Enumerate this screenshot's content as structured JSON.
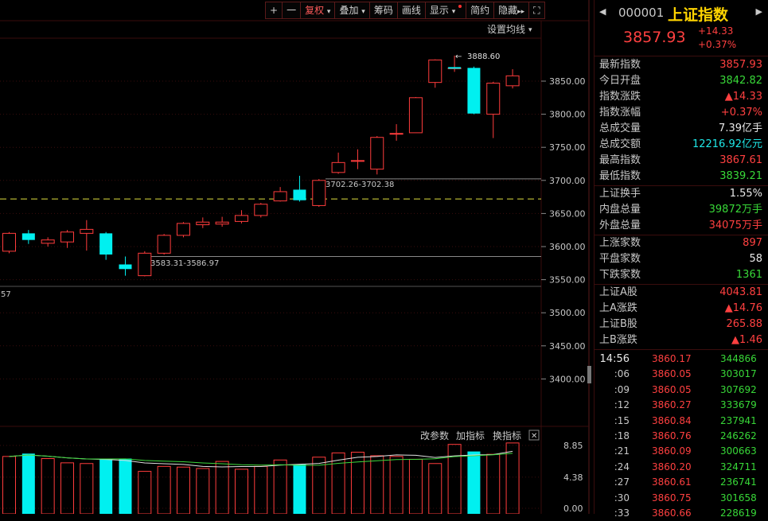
{
  "toolbar": {
    "plus": "+",
    "minus": "一",
    "fuquan": "复权",
    "diejia": "叠加",
    "chouma": "筹码",
    "huaxian": "画线",
    "xianshi": "显示",
    "jianyue": "简约",
    "yincang": "隐藏",
    "scroll_right": "▸▸",
    "fullscreen": "⛶"
  },
  "header": {
    "code": "000001",
    "name": "上证指数",
    "price": "3857.93",
    "change": "+14.33",
    "change_pct": "+0.37%",
    "nav_left": "◀",
    "nav_right": "▶"
  },
  "labels": {
    "set_ma": "设置均线",
    "high_marker": "3888.60",
    "range_top": "3702.26-3702.38",
    "range_bottom": "3583.31-3586.97",
    "lower_tag": "57",
    "gai_canshu": "改参数",
    "jia_zhibiao": "加指标",
    "huan_zhibiao": "换指标",
    "close_x": "✕"
  },
  "stats1": [
    {
      "label": "最新指数",
      "value": "3857.93",
      "color": "red"
    },
    {
      "label": "今日开盘",
      "value": "3842.82",
      "color": "green"
    },
    {
      "label": "指数涨跌",
      "value": "▲14.33",
      "color": "red"
    },
    {
      "label": "指数涨幅",
      "value": "+0.37%",
      "color": "red"
    },
    {
      "label": "总成交量",
      "value": "7.39亿手",
      "color": "white"
    },
    {
      "label": "总成交额",
      "value": "12216.92亿元",
      "color": "cyan"
    },
    {
      "label": "最高指数",
      "value": "3867.61",
      "color": "red"
    },
    {
      "label": "最低指数",
      "value": "3839.21",
      "color": "green"
    }
  ],
  "stats2": [
    {
      "label": "上证换手",
      "value": "1.55%",
      "color": "white"
    },
    {
      "label": "内盘总量",
      "value": "39872万手",
      "color": "green"
    },
    {
      "label": "外盘总量",
      "value": "34075万手",
      "color": "red"
    }
  ],
  "stats3": [
    {
      "label": "上涨家数",
      "value": "897",
      "color": "red"
    },
    {
      "label": "平盘家数",
      "value": "58",
      "color": "white"
    },
    {
      "label": "下跌家数",
      "value": "1361",
      "color": "green"
    }
  ],
  "stats4": [
    {
      "label": "上证A股",
      "value": "4043.81",
      "color": "red"
    },
    {
      "label": "上A涨跌",
      "value": "▲14.76",
      "color": "red"
    },
    {
      "label": "上证B股",
      "value": "265.88",
      "color": "red"
    },
    {
      "label": "上B涨跌",
      "value": "▲1.46",
      "color": "red"
    }
  ],
  "ticks": [
    {
      "time": "14:56",
      "price": "3860.17",
      "vol": "344866"
    },
    {
      "time": ":06",
      "price": "3860.05",
      "vol": "303017"
    },
    {
      "time": ":09",
      "price": "3860.05",
      "vol": "307692"
    },
    {
      "time": ":12",
      "price": "3860.27",
      "vol": "333679"
    },
    {
      "time": ":15",
      "price": "3860.84",
      "vol": "237941"
    },
    {
      "time": ":18",
      "price": "3860.76",
      "vol": "246262"
    },
    {
      "time": ":21",
      "price": "3860.09",
      "vol": "300663"
    },
    {
      "time": ":24",
      "price": "3860.20",
      "vol": "324711"
    },
    {
      "time": ":27",
      "price": "3860.61",
      "vol": "236741"
    },
    {
      "time": ":30",
      "price": "3860.75",
      "vol": "301658"
    },
    {
      "time": ":33",
      "price": "3860.66",
      "vol": "228619"
    }
  ],
  "colors": {
    "up": "#ff3c3c",
    "down": "#00f0f0",
    "grid": "#3a0d0d",
    "ma_white": "#d8d8d8",
    "ma_yellow": "#e8e060",
    "vol_ma1": "#e0e0e0",
    "vol_ma2": "#3cd83c"
  },
  "chart_data": {
    "type": "candlestick",
    "y_ticks": [
      "3850.00",
      "3800.00",
      "3750.00",
      "3700.00",
      "3650.00",
      "3600.00",
      "3550.00",
      "3500.00",
      "3450.00",
      "3400.00"
    ],
    "ylim": [
      3370,
      3905
    ],
    "reference_line": 3672,
    "candles": [
      {
        "o": 3593,
        "c": 3620,
        "h": 3622,
        "l": 3590
      },
      {
        "o": 3620,
        "c": 3610,
        "h": 3625,
        "l": 3604
      },
      {
        "o": 3605,
        "c": 3610,
        "h": 3614,
        "l": 3600
      },
      {
        "o": 3607,
        "c": 3622,
        "h": 3625,
        "l": 3598
      },
      {
        "o": 3620,
        "c": 3626,
        "h": 3640,
        "l": 3594
      },
      {
        "o": 3620,
        "c": 3588,
        "h": 3622,
        "l": 3580
      },
      {
        "o": 3573,
        "c": 3566,
        "h": 3585,
        "l": 3556
      },
      {
        "o": 3556,
        "c": 3590,
        "h": 3593,
        "l": 3555
      },
      {
        "o": 3590,
        "c": 3617,
        "h": 3619,
        "l": 3588
      },
      {
        "o": 3617,
        "c": 3635,
        "h": 3637,
        "l": 3614
      },
      {
        "o": 3633,
        "c": 3637,
        "h": 3644,
        "l": 3628
      },
      {
        "o": 3634,
        "c": 3637,
        "h": 3645,
        "l": 3630
      },
      {
        "o": 3638,
        "c": 3647,
        "h": 3655,
        "l": 3635
      },
      {
        "o": 3647,
        "c": 3664,
        "h": 3666,
        "l": 3644
      },
      {
        "o": 3669,
        "c": 3683,
        "h": 3690,
        "l": 3668
      },
      {
        "o": 3686,
        "c": 3670,
        "h": 3707,
        "l": 3668
      },
      {
        "o": 3662,
        "c": 3700,
        "h": 3702,
        "l": 3660
      },
      {
        "o": 3712,
        "c": 3727,
        "h": 3742,
        "l": 3710
      },
      {
        "o": 3730,
        "c": 3730,
        "h": 3747,
        "l": 3717
      },
      {
        "o": 3717,
        "c": 3765,
        "h": 3767,
        "l": 3709
      },
      {
        "o": 3770,
        "c": 3771,
        "h": 3785,
        "l": 3760
      },
      {
        "o": 3772,
        "c": 3825,
        "h": 3826,
        "l": 3772
      },
      {
        "o": 3848,
        "c": 3882,
        "h": 3883,
        "l": 3840
      },
      {
        "o": 3870,
        "c": 3870,
        "h": 3888.6,
        "l": 3864
      },
      {
        "o": 3870,
        "c": 3801,
        "h": 3872,
        "l": 3800
      },
      {
        "o": 3800,
        "c": 3847,
        "h": 3849,
        "l": 3764
      },
      {
        "o": 3843,
        "c": 3858,
        "h": 3868,
        "l": 3839
      }
    ],
    "volume": {
      "y_ticks": [
        "8.85",
        "4.38",
        "0.00"
      ],
      "ylim": [
        0,
        8.85
      ],
      "values": [
        7.3,
        7.7,
        7.0,
        6.4,
        6.3,
        7.0,
        7.0,
        5.2,
        5.9,
        5.8,
        5.6,
        6.6,
        5.5,
        5.9,
        6.8,
        6.2,
        7.2,
        7.8,
        7.9,
        7.4,
        7.3,
        6.9,
        6.3,
        9.0,
        8.0,
        7.6,
        9.2
      ]
    }
  }
}
